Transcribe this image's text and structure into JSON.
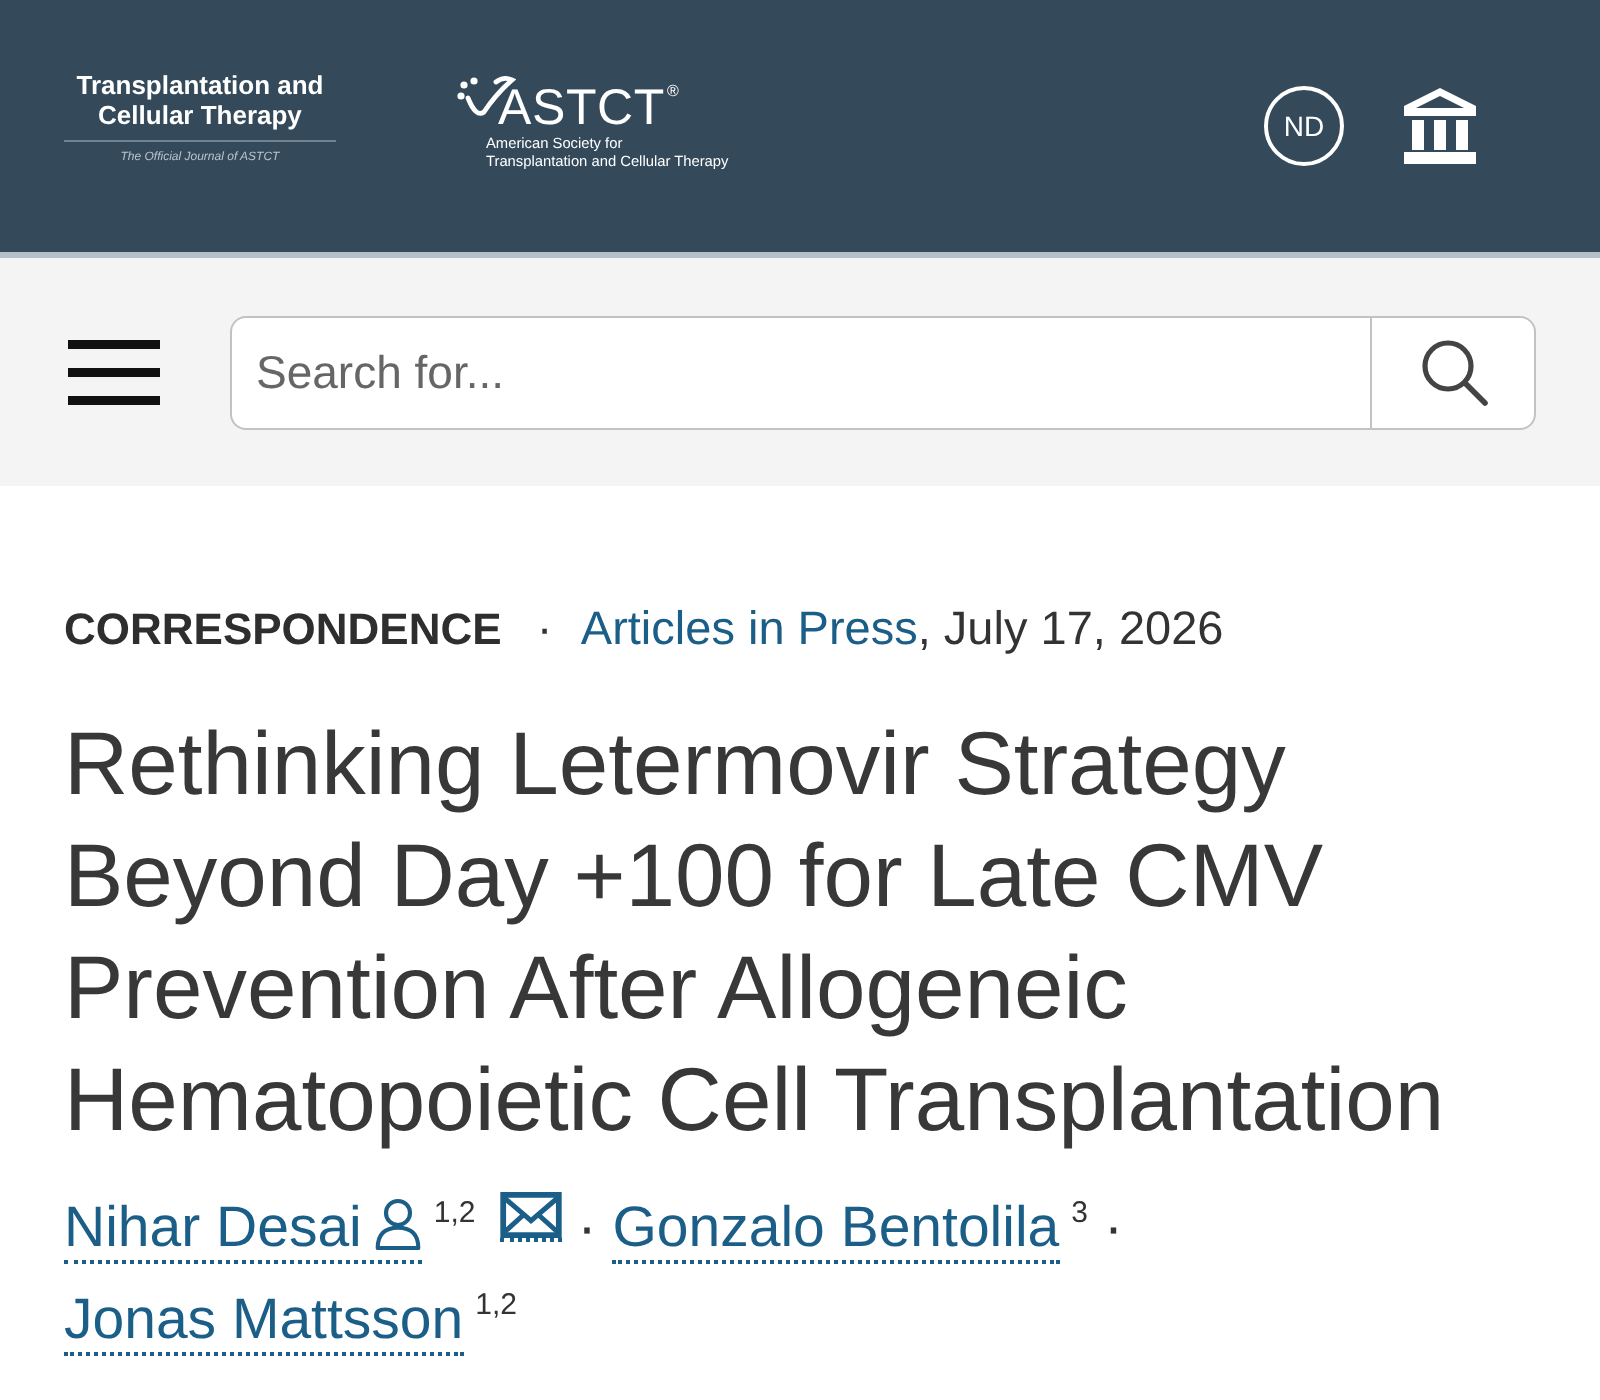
{
  "header": {
    "journal_logo": {
      "title_lines": [
        "Transplantation and",
        "Cellular Therapy"
      ],
      "tagline": "The Official Journal of ASTCT"
    },
    "society_logo": {
      "name": "ASTCT",
      "registered_mark": "®",
      "subtitle_lines": [
        "American Society for",
        "Transplantation and Cellular Therapy"
      ]
    },
    "account": {
      "initials": "ND"
    }
  },
  "search": {
    "placeholder": "Search for..."
  },
  "article": {
    "category": "CORRESPONDENCE",
    "category_separator": "·",
    "section_link": "Articles in Press",
    "date": ", July 17, 2026",
    "title_lines": [
      "Rethinking Letermovir Strategy",
      "Beyond Day +100 for Late CMV",
      "Prevention After Allogeneic",
      "Hematopoietic Cell Transplantation"
    ],
    "author_separator": "·",
    "authors": [
      {
        "name": "Nihar Desai",
        "profile": true,
        "affiliations": "1,2",
        "email": true
      },
      {
        "name": "Gonzalo Bentolila",
        "profile": false,
        "affiliations": "3",
        "email": false
      },
      {
        "name": "Jonas Mattsson",
        "profile": false,
        "affiliations": "1,2",
        "email": false
      }
    ]
  }
}
